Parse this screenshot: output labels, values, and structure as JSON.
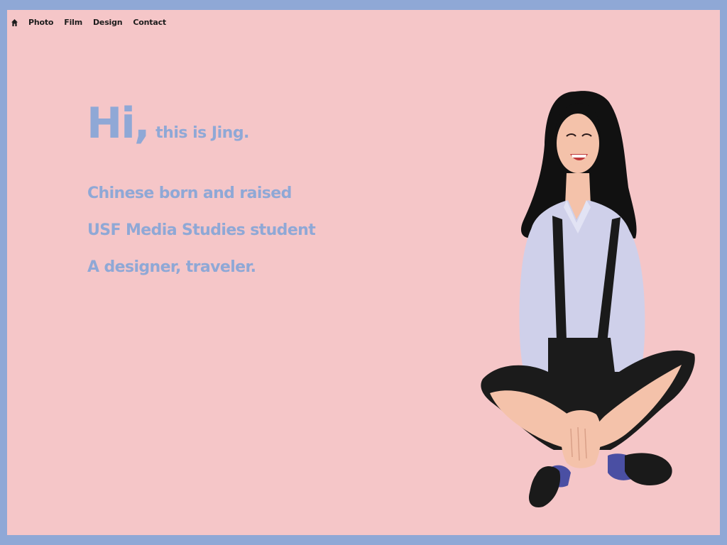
{
  "nav": {
    "home_icon": "home-icon",
    "items": [
      "Photo",
      "Film",
      "Design",
      "Contact"
    ]
  },
  "hero": {
    "greeting": "Hi,",
    "intro": "this is Jing.",
    "lines": [
      "Chinese born and raised",
      "USF Media Studies student",
      "A designer, traveler."
    ]
  },
  "colors": {
    "background": "#f5c6c8",
    "border": "#8fa8d6",
    "accent_text": "#8fa8d6",
    "nav_text": "#1c1c1c"
  },
  "illustration": {
    "icon": "portrait-illustration"
  }
}
